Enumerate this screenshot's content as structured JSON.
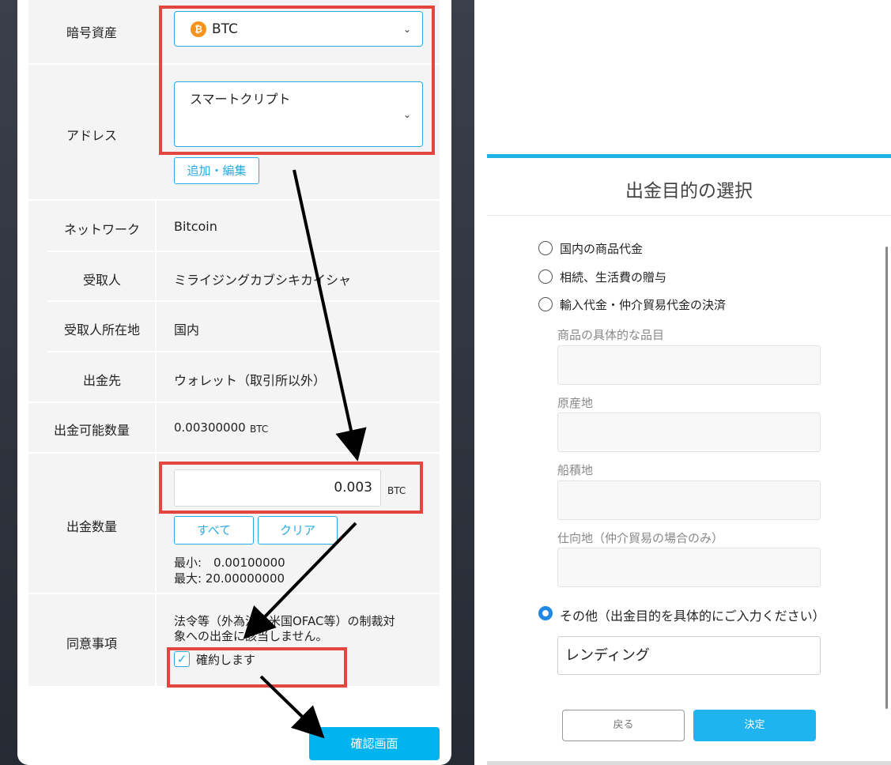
{
  "left_form": {
    "crypto_label": "暗号資産",
    "crypto_value": "BTC",
    "crypto_icon": "bitcoin-icon",
    "address_label": "アドレス",
    "address_value": "スマートクリプト",
    "add_edit_button": "追加・編集",
    "network_label": "ネットワーク",
    "network_value": "Bitcoin",
    "recipient_label": "受取人",
    "recipient_value": "ミライジングカブシキカイシャ",
    "recipient_location_label": "受取人所在地",
    "recipient_location_value": "国内",
    "destination_label": "出金先",
    "destination_value": "ウォレット（取引所以外）",
    "available_label": "出金可能数量",
    "available_value": "0.00300000",
    "available_unit": "BTC",
    "amount_label": "出金数量",
    "amount_value": "0.003",
    "amount_unit": "BTC",
    "all_button": "すべて",
    "clear_button": "クリア",
    "min_text": "最小:　0.00100000",
    "max_text": "最大: 20.00000000",
    "consent_label": "同意事項",
    "consent_text_1": "法令等（外為法・米国OFAC等）の制裁対",
    "consent_text_2": "象への出金に該当しません。",
    "checkbox_label": "確約します",
    "checkbox_checked": true,
    "confirm_button": "確認画面"
  },
  "modal": {
    "title": "出金目的の選択",
    "options": [
      "国内の商品代金",
      "相続、生活費の贈与",
      "輸入代金・仲介貿易代金の決済"
    ],
    "fields": [
      "商品の具体的な品目",
      "原産地",
      "船積地",
      "仕向地（仲介貿易の場合のみ）"
    ],
    "other_option": "その他（出金目的を具体的にご入力ください）",
    "other_selected": true,
    "other_value": "レンディング",
    "back_button": "戻る",
    "ok_button": "決定"
  },
  "colors": {
    "accent": "#29abe2",
    "highlight": "#e2463f",
    "radio_selected": "#1e88e5"
  }
}
